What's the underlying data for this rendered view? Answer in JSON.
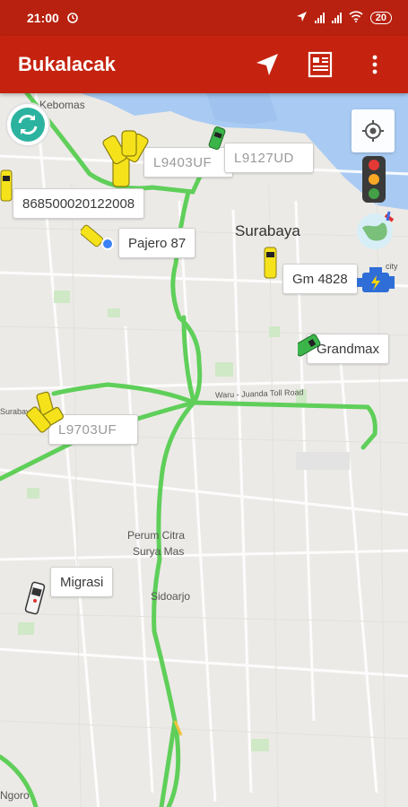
{
  "status_bar": {
    "time": "21:00",
    "battery": "20"
  },
  "app_bar": {
    "title": "Bukalacak",
    "actions": [
      "navigate-icon",
      "report-icon",
      "overflow-menu-icon"
    ]
  },
  "map": {
    "places": {
      "kebomas": "Kebomas",
      "surabaya": "Surabaya",
      "perum_line1": "Perum Citra",
      "perum_line2": "Surya Mas",
      "sidoarjo": "Sidoarjo",
      "ngoro": "Ngoro"
    },
    "roads": {
      "toll": "Waru - Juanda Toll Road",
      "surabaya_west": "Surabaya",
      "city": "city"
    },
    "vehicles": [
      {
        "label": "L9403UF",
        "style": "blurred"
      },
      {
        "label": "L9127UD",
        "style": "blurred"
      },
      {
        "label": "868500020122008",
        "style": "normal"
      },
      {
        "label": "Pajero 87",
        "style": "normal"
      },
      {
        "label": "Gm 4828",
        "style": "normal"
      },
      {
        "label": "Grandmax",
        "style": "normal"
      },
      {
        "label": "L9703UF",
        "style": "blurred"
      },
      {
        "label": "Migrasi",
        "style": "normal"
      }
    ],
    "colors": {
      "route": "#5fcf5a",
      "app_bar": "#c5230f",
      "car_yellow": "#f5e21b",
      "car_green": "#3bb54a"
    }
  }
}
